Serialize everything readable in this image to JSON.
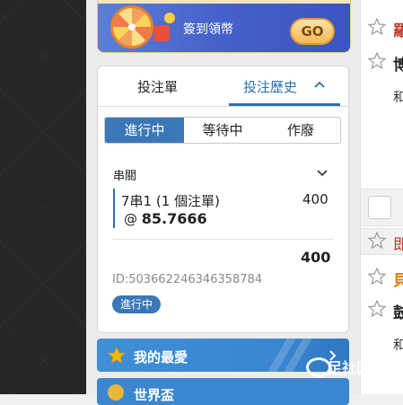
{
  "promo": {
    "text": "簽到領幣",
    "go_label": "GO"
  },
  "betslip": {
    "tabs": [
      {
        "label": "投注單"
      },
      {
        "label": "投注歷史"
      }
    ],
    "filters": [
      "進行中",
      "等待中",
      "作廢"
    ],
    "bet": {
      "type": "串關",
      "selection_line": "7串1 (1 個注單)",
      "stake": "400",
      "odds_prefix": "@",
      "odds": "85.7666",
      "total": "400",
      "id": "ID:503662246346358784",
      "status": "進行中"
    }
  },
  "favorites": {
    "label": "我的最愛"
  },
  "world_cup": {
    "label": "世界盃"
  },
  "right_panel": {
    "rows": [
      {
        "text": "羅"
      },
      {
        "text": "博"
      },
      {
        "text": "和"
      },
      {
        "text": "即"
      },
      {
        "text": "貝"
      },
      {
        "text": "鼓"
      },
      {
        "text": "和"
      }
    ]
  },
  "watermark": {
    "text": "足社区",
    "sub": "BOSSHEQU"
  },
  "colors": {
    "accent": "#2c6fb6",
    "active_filter": "#3a78b8",
    "favorites_bar": "#3f8fd6",
    "go_button": "#f2b857"
  },
  "icons": [
    "star-icon",
    "chevron-up-icon",
    "chevron-down-icon",
    "chevron-right-icon",
    "trophy-icon",
    "wheel-icon"
  ]
}
